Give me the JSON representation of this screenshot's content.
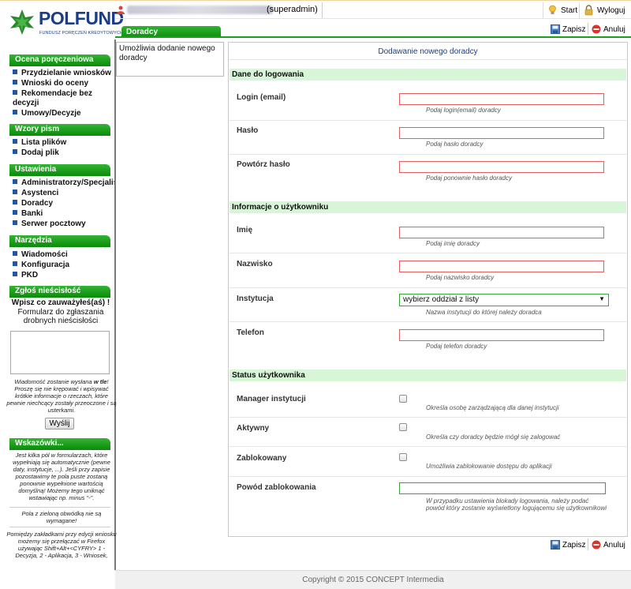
{
  "brand": {
    "name": "POLFUND",
    "tagline": "FUNDUSZ PORĘCZEŃ KREDYTOWYCH"
  },
  "topbar": {
    "user_role": "(superadmin)",
    "start_label": "Start",
    "logout_label": "Wyloguj"
  },
  "header": {
    "tab_label": "Doradcy",
    "save_label": "Zapisz",
    "cancel_label": "Anuluj"
  },
  "sidebar": {
    "sections": [
      {
        "title": "Ocena poręczeniowa",
        "items": [
          "Przydzielanie wniosków",
          "Wnioski do oceny",
          "Rekomendacje bez decyzji",
          "Umowy/Decyzje"
        ]
      },
      {
        "title": "Wzory pism",
        "items": [
          "Lista plików",
          "Dodaj plik"
        ]
      },
      {
        "title": "Ustawienia",
        "items": [
          "Administratorzy/Specjaliści",
          "Asystenci",
          "Doradcy",
          "Banki",
          "Serwer pocztowy"
        ]
      },
      {
        "title": "Narzędzia",
        "items": [
          "Wiadomości",
          "Konfiguracja",
          "PKD"
        ]
      }
    ],
    "report": {
      "title": "Zgłoś nieścisłość",
      "heading": "Wpisz co zauważyłeś(aś) !",
      "subheading": "Formularz do zgłaszania drobnych nieścisłości",
      "note_prefix": "Wiadomość zostanie wysłana ",
      "note_bold": "w tle",
      "note_suffix": "! Proszę się nie krępować i wpisywać krótkie informacje o rzeczach, które pewnie niechcący zostały przeoczone i są usterkami.",
      "send_label": "Wyślij"
    },
    "hints": {
      "title": "Wskazówki...",
      "text1": "Jest kilka pól w formularzach, które wypełniają się automatycznie (pewne daty, instytucje, ...). Jeśli przy zapisie pozostawimy te pola puste zostaną ponownie wypełnione wartością domyślną! Możemy tego uniknąć wstawiając np. minus \"-\".",
      "text2": "Pola z zieloną obwódką nie są wymagane!",
      "text3": "Pomiędzy zakładkami przy edycji wniosku możemy się przełączać w Firefox używając Shift+Alt+<CYFRY> 1 - Decyzja, 2 - Aplikacja, 3 - Wniosek,"
    }
  },
  "description": "Umożliwia dodanie nowego doradcy",
  "form": {
    "title": "Dodawanie nowego doradcy",
    "sections": [
      {
        "title": "Dane do logowania",
        "fields": [
          {
            "label": "Login (email)",
            "hint": "Podaj login(email) doradcy"
          },
          {
            "label": "Hasło",
            "hint": "Podaj hasło doradcy"
          },
          {
            "label": "Powtórz hasło",
            "hint": "Podaj ponownie hasło doradcy"
          }
        ]
      },
      {
        "title": "Informacje o użytkowniku",
        "fields": [
          {
            "label": "Imię",
            "hint": "Podaj imię doradcy"
          },
          {
            "label": "Nazwisko",
            "hint": "Podaj nazwisko doradcy"
          },
          {
            "label": "Instytucja",
            "hint": "Nazwa instytucji do której należy doradca",
            "selected": "wybierz oddział z listy"
          },
          {
            "label": "Telefon",
            "hint": "Podaj telefon doradcy"
          }
        ]
      },
      {
        "title": "Status użytkownika",
        "fields": [
          {
            "label": "Manager instytucji",
            "hint": "Określa osobę zarządzającą dla danej instytucji"
          },
          {
            "label": "Aktywny",
            "hint": "Określa czy doradcy będzie mógł się zalogować"
          },
          {
            "label": "Zablokowany",
            "hint": "Umożliwia zablokowanie dostępu do aplikacji"
          },
          {
            "label": "Powód zablokowania",
            "hint": "W przypadku ustawienia blokady logowania, należy podać powód który zostanie wyświetlony logującemu się użytkownikowi"
          }
        ]
      }
    ]
  },
  "footer": {
    "text": "Copyright © 2015 CONCEPT Intermedia"
  },
  "colors": {
    "accent_green": "#1aa01a",
    "brand_blue": "#1c3d86",
    "section_bg": "#d7f6d7",
    "required_border": "#e46060",
    "optional_border": "#3aa33a"
  }
}
